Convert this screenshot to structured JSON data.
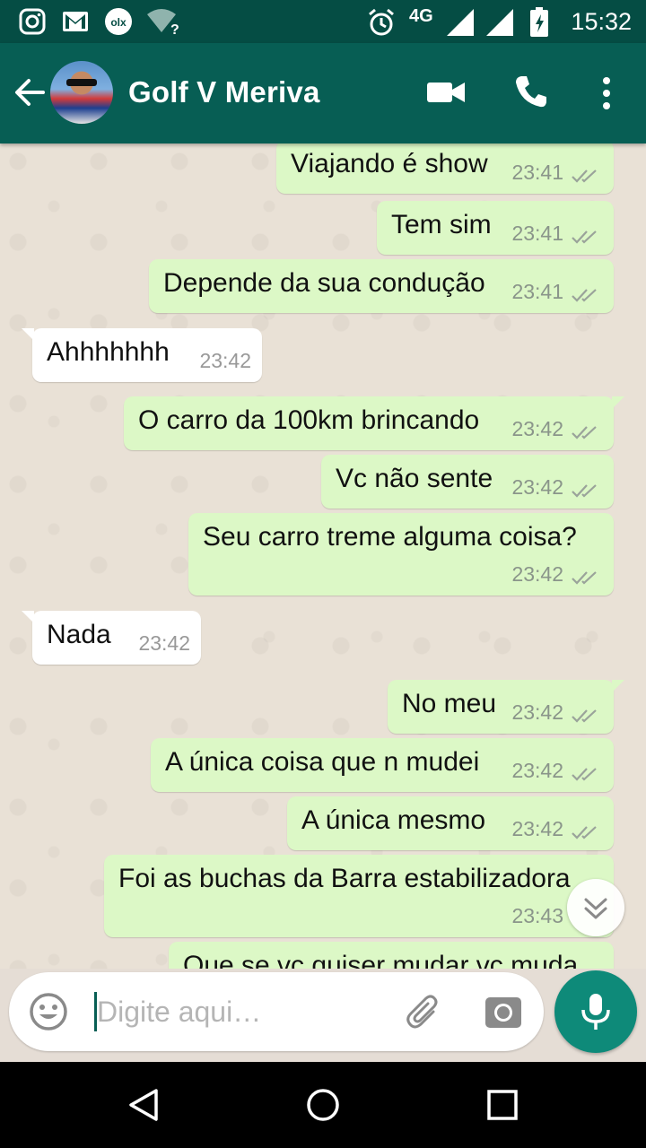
{
  "status_bar": {
    "time": "15:32",
    "network": "4G",
    "icons": [
      "instagram-icon",
      "gmail-icon",
      "olx-icon",
      "wifi-unknown-icon",
      "alarm-icon",
      "signal-icon",
      "battery-icon"
    ]
  },
  "header": {
    "contact_name": "Golf V Meriva",
    "icons": [
      "back-arrow-icon",
      "video-call-icon",
      "phone-icon",
      "more-vert-icon"
    ],
    "color": "#075e54"
  },
  "messages": [
    {
      "text": "Viajando é show",
      "time": "23:41",
      "direction": "out"
    },
    {
      "text": "Tem sim",
      "time": "23:41",
      "direction": "out"
    },
    {
      "text": "Depende da sua condução",
      "time": "23:41",
      "direction": "out"
    },
    {
      "text": "Ahhhhhhh",
      "time": "23:42",
      "direction": "in"
    },
    {
      "text": "O carro da 100km brincando",
      "time": "23:42",
      "direction": "out"
    },
    {
      "text": "Vc não sente",
      "time": "23:42",
      "direction": "out"
    },
    {
      "text": "Seu carro treme alguma coisa?",
      "time": "23:42",
      "direction": "out"
    },
    {
      "text": "Nada",
      "time": "23:42",
      "direction": "in"
    },
    {
      "text": "No meu",
      "time": "23:42",
      "direction": "out"
    },
    {
      "text": "A única coisa que n mudei",
      "time": "23:42",
      "direction": "out"
    },
    {
      "text": "A única mesmo",
      "time": "23:42",
      "direction": "out"
    },
    {
      "text": "Foi as buchas da Barra estabilizadora",
      "time": "23:43",
      "direction": "out"
    },
    {
      "text": "Que se vc quiser mudar vc muda",
      "time": "",
      "direction": "out"
    }
  ],
  "composer": {
    "placeholder": "Digite aqui…",
    "icons": [
      "emoji-icon",
      "attach-icon",
      "camera-icon",
      "mic-icon"
    ]
  },
  "colors": {
    "outgoing_bubble": "#dcf8c6",
    "incoming_bubble": "#ffffff",
    "accent": "#0e8a79"
  }
}
